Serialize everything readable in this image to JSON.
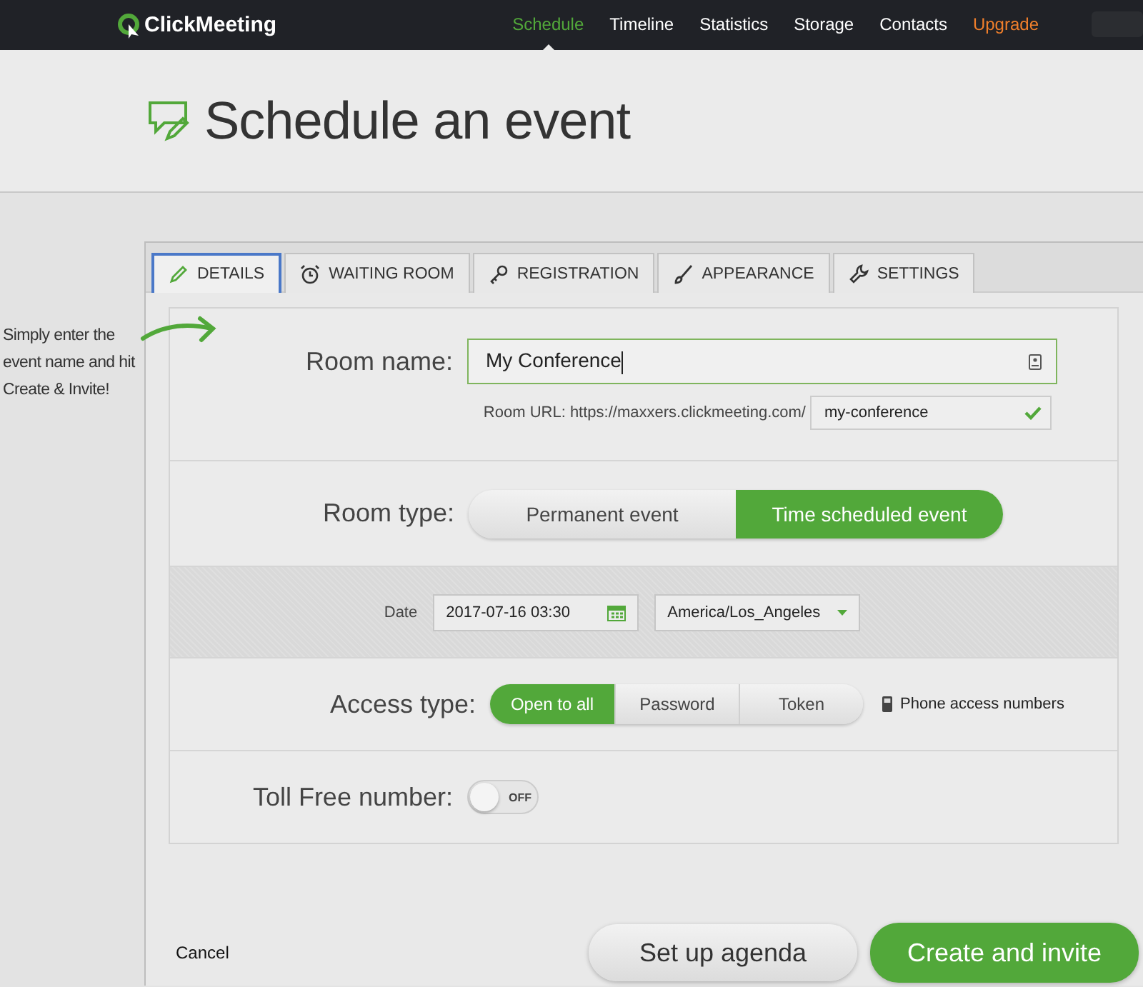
{
  "nav": {
    "logo": "ClickMeeting",
    "items": [
      {
        "label": "Schedule",
        "selected": true,
        "kind": "link"
      },
      {
        "label": "Timeline",
        "selected": false,
        "kind": "link"
      },
      {
        "label": "Statistics",
        "selected": false,
        "kind": "link"
      },
      {
        "label": "Storage",
        "selected": false,
        "kind": "link"
      },
      {
        "label": "Contacts",
        "selected": false,
        "kind": "link"
      },
      {
        "label": "Upgrade",
        "selected": false,
        "kind": "upgrade"
      }
    ]
  },
  "page_title": "Schedule an event",
  "hint": "Simply enter the event name and hit Create & Invite!",
  "tabs": [
    {
      "label": "DETAILS",
      "selected": true
    },
    {
      "label": "WAITING ROOM",
      "selected": false
    },
    {
      "label": "REGISTRATION",
      "selected": false
    },
    {
      "label": "APPEARANCE",
      "selected": false
    },
    {
      "label": "SETTINGS",
      "selected": false
    }
  ],
  "room_name": {
    "label": "Room name:",
    "value": "My Conference"
  },
  "room_url": {
    "label": "Room URL: https://maxxers.clickmeeting.com/",
    "value": "my-conference"
  },
  "room_type": {
    "label": "Room type:",
    "options": [
      {
        "label": "Permanent event",
        "selected": false
      },
      {
        "label": "Time scheduled event",
        "selected": true
      }
    ]
  },
  "date": {
    "label": "Date",
    "value": "2017-07-16 03:30",
    "timezone": "America/Los_Angeles"
  },
  "access_type": {
    "label": "Access type:",
    "options": [
      {
        "label": "Open to all",
        "selected": true
      },
      {
        "label": "Password",
        "selected": false
      },
      {
        "label": "Token",
        "selected": false
      }
    ],
    "phone_link": "Phone access numbers"
  },
  "toll_free": {
    "label": "Toll Free number:",
    "on": false,
    "state_text": "OFF"
  },
  "buttons": {
    "cancel": "Cancel",
    "agenda": "Set up agenda",
    "create": "Create and invite"
  }
}
